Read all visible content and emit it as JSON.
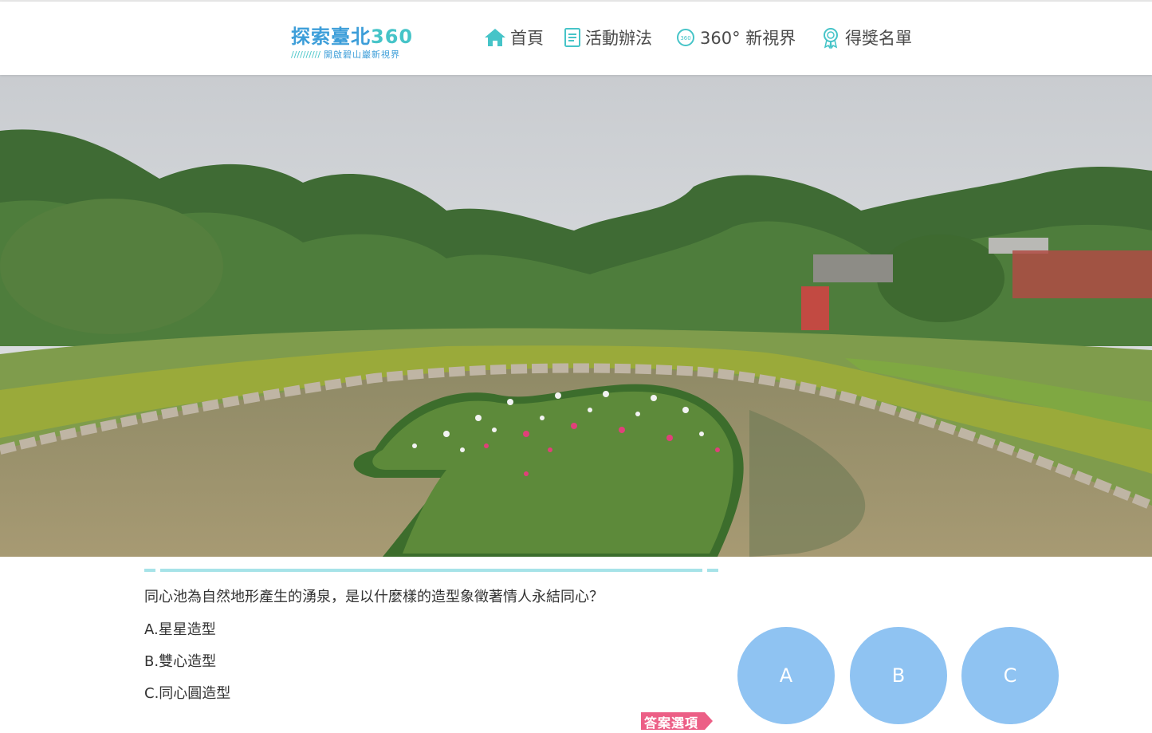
{
  "header": {
    "logo": {
      "title_main": "探索臺北",
      "title_num": "360",
      "subtitle": "開啟碧山巖新視界",
      "ticks": "//////////"
    },
    "nav": [
      {
        "label": "首頁",
        "icon": "home-icon"
      },
      {
        "label": "活動辦法",
        "icon": "document-icon"
      },
      {
        "label": "360° 新視界",
        "icon": "360-badge-icon"
      },
      {
        "label": "得獎名單",
        "icon": "award-ribbon-icon"
      }
    ]
  },
  "panorama": {
    "subject": "heart-shaped-pond-with-flower-island",
    "icon": "panorama-image"
  },
  "quiz": {
    "question": "同心池為自然地形產生的湧泉，是以什麼樣的造型象徵著情人永結同心？",
    "options": [
      "A.星星造型",
      "B.雙心造型",
      "C.同心圓造型"
    ],
    "answer_tag": "答案選項",
    "answer_buttons": [
      "A",
      "B",
      "C"
    ]
  },
  "colors": {
    "accent_teal": "#46c4c8",
    "logo_blue": "#3d9ed9",
    "answer_button": "#8fc3f2",
    "answer_tag": "#ec5f86",
    "divider": "#a6e3e8"
  }
}
